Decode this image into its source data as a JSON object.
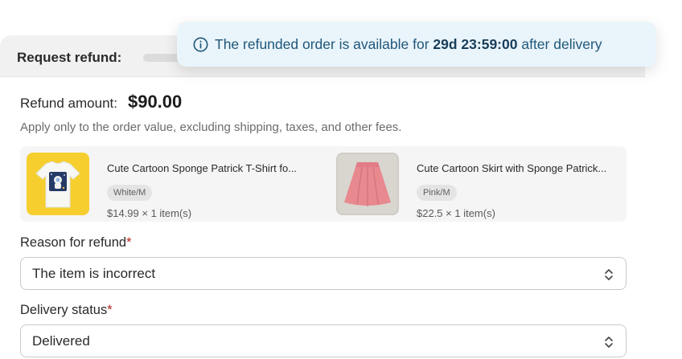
{
  "header": {
    "title": "Request refund:"
  },
  "toast": {
    "icon": "info-icon",
    "prefix": "The refunded order is available for ",
    "countdown": "29d 23:59:00",
    "suffix": " after delivery"
  },
  "refund": {
    "amount_label": "Refund amount:",
    "amount_value": "$90.00",
    "note": "Apply only to the order value, excluding shipping, taxes, and other fees."
  },
  "items": [
    {
      "name": "Cute Cartoon Sponge Patrick T-Shirt fo...",
      "variant": "White/M",
      "price": "$14.99 × 1 item(s)",
      "thumb": "yellow-tshirt-image"
    },
    {
      "name": "Cute Cartoon Skirt with Sponge Patrick...",
      "variant": "Pink/M",
      "price": "$22.5 × 1 item(s)",
      "thumb": "pink-skirt-image"
    }
  ],
  "reason": {
    "label": "Reason for refund",
    "required_mark": "*",
    "value": "The item is incorrect"
  },
  "delivery": {
    "label": "Delivery status",
    "required_mark": "*",
    "value": "Delivered"
  },
  "colors": {
    "toast_bg": "#eaf4fb",
    "toast_text": "#20577a",
    "required": "#b3261e",
    "tshirt_bg": "#f6cf2e",
    "skirt": "#e8888f"
  }
}
